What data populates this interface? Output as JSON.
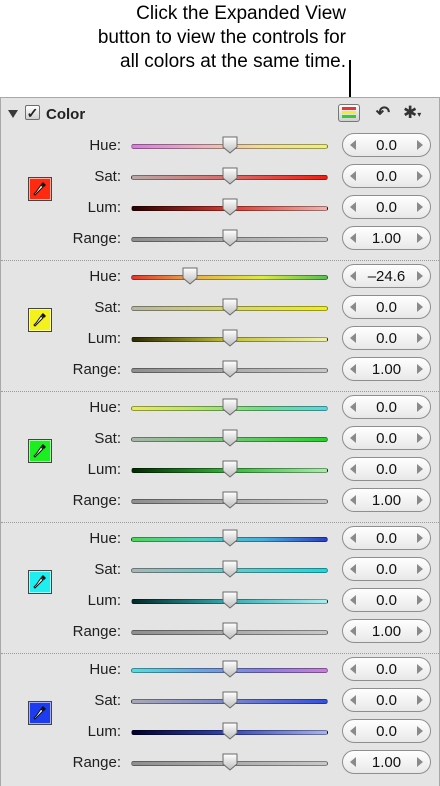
{
  "callout": {
    "lines": [
      "Click the Expanded View",
      "button to view the controls for",
      "all colors at the same time."
    ]
  },
  "panel": {
    "title": "Color",
    "enabled": true,
    "checkbox_mark": "✓",
    "icons": {
      "expand": "expanded-view-icon",
      "reset": "reset-arrow-icon",
      "settings": "gear-icon"
    }
  },
  "groups": [
    {
      "swatch_color": "#ff2a10",
      "rows": [
        {
          "label": "Hue:",
          "value": "0.0",
          "position": 0.5,
          "track": "linear-gradient(90deg,#d57ed9,#e9b0c4,#f2dd94,#eef07b)"
        },
        {
          "label": "Sat:",
          "value": "0.0",
          "position": 0.5,
          "track": "linear-gradient(90deg,#b9a8a8,#d96b67,#f01d12)"
        },
        {
          "label": "Lum:",
          "value": "0.0",
          "position": 0.5,
          "track": "linear-gradient(90deg,#2a0000,#d93a30,#f3b3ae)"
        },
        {
          "label": "Range:",
          "value": "1.00",
          "position": 0.5,
          "track": "linear-gradient(90deg,#8e8e8e,#c8c8c8)"
        }
      ]
    },
    {
      "swatch_color": "#f4f21c",
      "rows": [
        {
          "label": "Hue:",
          "value": "–24.6",
          "position": 0.3,
          "track": "linear-gradient(90deg,#e3382c,#e7b24a,#dcea3e,#56c04e)"
        },
        {
          "label": "Sat:",
          "value": "0.0",
          "position": 0.5,
          "track": "linear-gradient(90deg,#b6b6a6,#d6d56a,#eeee22)"
        },
        {
          "label": "Lum:",
          "value": "0.0",
          "position": 0.5,
          "track": "linear-gradient(90deg,#2a2a00,#c4c338,#eff0a8)"
        },
        {
          "label": "Range:",
          "value": "1.00",
          "position": 0.5,
          "track": "linear-gradient(90deg,#8e8e8e,#c8c8c8)"
        }
      ]
    },
    {
      "swatch_color": "#1cef20",
      "rows": [
        {
          "label": "Hue:",
          "value": "0.0",
          "position": 0.5,
          "track": "linear-gradient(90deg,#e8ea5e,#b4e668,#6fdc8a,#5ad6e3)"
        },
        {
          "label": "Sat:",
          "value": "0.0",
          "position": 0.5,
          "track": "linear-gradient(90deg,#a8b6a8,#70c872,#26d02a)"
        },
        {
          "label": "Lum:",
          "value": "0.0",
          "position": 0.5,
          "track": "linear-gradient(90deg,#002a00,#36b53a,#a9eeac)"
        },
        {
          "label": "Range:",
          "value": "1.00",
          "position": 0.5,
          "track": "linear-gradient(90deg,#8e8e8e,#c8c8c8)"
        }
      ]
    },
    {
      "swatch_color": "#1feef0",
      "rows": [
        {
          "label": "Hue:",
          "value": "0.0",
          "position": 0.5,
          "track": "linear-gradient(90deg,#4cd65a,#4fd0b8,#45b0de,#2b3fc4)"
        },
        {
          "label": "Sat:",
          "value": "0.0",
          "position": 0.5,
          "track": "linear-gradient(90deg,#a8b6b6,#6ac8cb,#20d6da)"
        },
        {
          "label": "Lum:",
          "value": "0.0",
          "position": 0.5,
          "track": "linear-gradient(90deg,#002a2a,#34aeb3,#a9eef0)"
        },
        {
          "label": "Range:",
          "value": "1.00",
          "position": 0.5,
          "track": "linear-gradient(90deg,#8e8e8e,#c8c8c8)"
        }
      ]
    },
    {
      "swatch_color": "#1d3cf2",
      "rows": [
        {
          "label": "Hue:",
          "value": "0.0",
          "position": 0.5,
          "track": "linear-gradient(90deg,#55dde0,#6aa6e3,#8a7ee0,#c77fdb)"
        },
        {
          "label": "Sat:",
          "value": "0.0",
          "position": 0.5,
          "track": "linear-gradient(90deg,#a8a8b8,#7a86cc,#3450e0)"
        },
        {
          "label": "Lum:",
          "value": "0.0",
          "position": 0.5,
          "track": "linear-gradient(90deg,#00002a,#3446b8,#aab4ef)"
        },
        {
          "label": "Range:",
          "value": "1.00",
          "position": 0.5,
          "track": "linear-gradient(90deg,#8e8e8e,#c8c8c8)"
        }
      ]
    }
  ]
}
